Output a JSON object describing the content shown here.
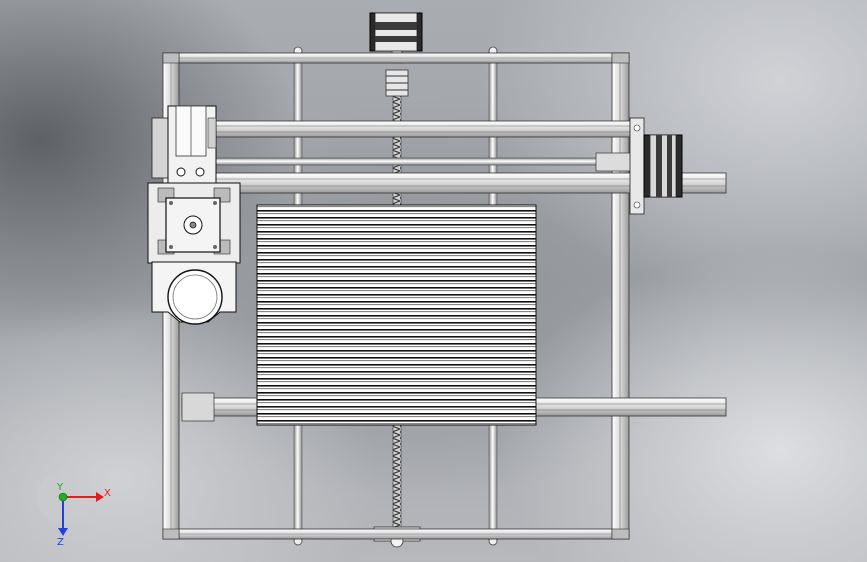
{
  "view": {
    "background": "#a3a6ab"
  },
  "triad": {
    "x_label": "X",
    "y_label": "Y",
    "z_label": "Z",
    "x_color": "#e02020",
    "y_color": "#20b020",
    "z_color": "#2040e0"
  },
  "parts": {
    "frame": "aluminum-extrusion-frame",
    "rods": "smooth-rods",
    "leadscrew": "y-lead-screw",
    "bed": "slotted-bed",
    "carriage": "x-carriage",
    "motors": [
      "stepper-motor-top",
      "stepper-motor-right",
      "stepper-motor-carriage"
    ],
    "spindle": "spindle-clamp"
  }
}
